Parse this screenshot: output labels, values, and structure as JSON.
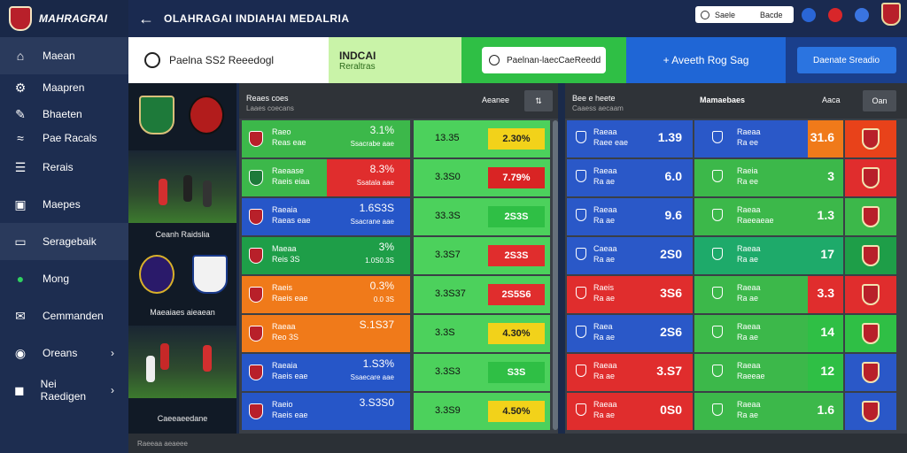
{
  "app": {
    "brand": "MAHRAGRAI",
    "top_title": "OLAHRAGAI INDIAHAI MEDALRIA"
  },
  "search": {
    "placeholder": "Saele",
    "label": "Bacde"
  },
  "sidebar": {
    "items": [
      {
        "label": "Maean",
        "icon": "home-icon"
      },
      {
        "label": "Maapren",
        "icon": "gear-icon"
      },
      {
        "label": "Bhaeten",
        "icon": "pen-icon"
      },
      {
        "label": "Pae Racals",
        "icon": "wave-icon"
      },
      {
        "label": "Rerais",
        "icon": "list-icon"
      },
      {
        "label": "Maepes",
        "icon": "box-icon"
      },
      {
        "label": "Seragebaik",
        "icon": "monitor-icon"
      },
      {
        "label": "Mong",
        "icon": "circle-icon"
      },
      {
        "label": "Cemmanden",
        "icon": "chat-icon"
      },
      {
        "label": "Oreans",
        "icon": "ball-icon"
      },
      {
        "label": "Nei Raedigen",
        "icon": "flag-icon"
      }
    ]
  },
  "tabs": {
    "t1": "Paelna SS2 Reeedogl",
    "t2a": "INDCAI",
    "t2b": "Reraltras",
    "t3": "Paelnan-laecCaeReedd",
    "t4": "+ Aveeth Rog Sag",
    "t5": "Daenate Sreadio"
  },
  "left_panel": {
    "h1": "Reaes coes",
    "h2": "Laaes coecans",
    "h3": "Aeanee",
    "btn": "⇅"
  },
  "right_panel": {
    "h1": "Bee e heete",
    "h2": "Caaess aecaam",
    "h3": "Mamaebaes",
    "h4": "Aaca",
    "btn": "Oan"
  },
  "match_captions": [
    "Ceanh Raidslia",
    "Maeaiaes aieaean",
    "Caeeaeedane"
  ],
  "left_rows": [
    {
      "n1": "Raeo",
      "n2": "Reas eae",
      "val": "3.1%",
      "sub": "Ssacrabe aae",
      "mid": "13.35",
      "pct": "2.30%"
    },
    {
      "n1": "Raeaase",
      "n2": "Raeis eiaa",
      "val": "8.3%",
      "sub": "Ssatala aae",
      "mid": "3.3S0",
      "pct": "7.79%"
    },
    {
      "n1": "Raeaia",
      "n2": "Raeas eae",
      "val": "1.6S3S",
      "sub": "Ssacrane aae",
      "mid": "33.3S",
      "pct": "2S3S"
    },
    {
      "n1": "Maeaa",
      "n2": "Reis 3S",
      "val": "3%",
      "sub": "1.0S0.3S",
      "mid": "3.3S7",
      "pct": "2S3S"
    },
    {
      "n1": "Raeis",
      "n2": "Raeis eae",
      "val": "0.3%",
      "sub": "0.0 3S",
      "mid": "3.3S37",
      "pct": "2S5S6"
    },
    {
      "n1": "Raeaa",
      "n2": "Reo 3S",
      "val": "S.1S37",
      "sub": "",
      "mid": "3.3S",
      "pct": "4.30%"
    },
    {
      "n1": "Raeaia",
      "n2": "Raeis eae",
      "val": "1.S3%",
      "sub": "Ssaecare aae",
      "mid": "3.3S3",
      "pct": "S3S"
    },
    {
      "n1": "Raeio",
      "n2": "Raeis eae",
      "val": "3.S3S0",
      "sub": "",
      "mid": "3.3S9",
      "pct": "4.50%"
    }
  ],
  "right_rows": [
    {
      "n1": "Raeaa",
      "n2": "Raee eae",
      "big": "1.39",
      "m1": "Raeaa",
      "m2": "Ra ee",
      "big2": "31.6"
    },
    {
      "n1": "Raeaa",
      "n2": "Ra ae",
      "big": "6.0",
      "m1": "Raeia",
      "m2": "Ra ee",
      "big2": "3"
    },
    {
      "n1": "Raeaa",
      "n2": "Ra ae",
      "big": "9.6",
      "m1": "Raeaa",
      "m2": "Raeeaeae",
      "big2": "1.3"
    },
    {
      "n1": "Caeaa",
      "n2": "Ra ae",
      "big": "2S0",
      "m1": "Raeaa",
      "m2": "Ra ae",
      "big2": "17"
    },
    {
      "n1": "Raeis",
      "n2": "Ra ae",
      "big": "3S6",
      "m1": "Raeaa",
      "m2": "Ra ae",
      "big2": "3.3"
    },
    {
      "n1": "Raea",
      "n2": "Ra ae",
      "big": "2S6",
      "m1": "Raeaa",
      "m2": "Ra ae",
      "big2": "14"
    },
    {
      "n1": "Raeaa",
      "n2": "Ra ae",
      "big": "3.S7",
      "m1": "Raeaa",
      "m2": "Raeeae",
      "big2": "12"
    },
    {
      "n1": "Raeaa",
      "n2": "Ra ae",
      "big": "0S0",
      "m1": "Raeaa",
      "m2": "Ra ae",
      "big2": "1.6"
    }
  ],
  "bottom": {
    "text": "Raeeaa aeaeee"
  },
  "colors": {
    "sidebar": "#1d2d50",
    "accent_green": "#2fbf45",
    "accent_blue": "#1f66d6",
    "row_green": "#3cb84a",
    "row_red": "#e02d2d",
    "row_blue": "#2656c8",
    "row_orange": "#f07a1a",
    "row_yellow": "#f2d21a"
  }
}
